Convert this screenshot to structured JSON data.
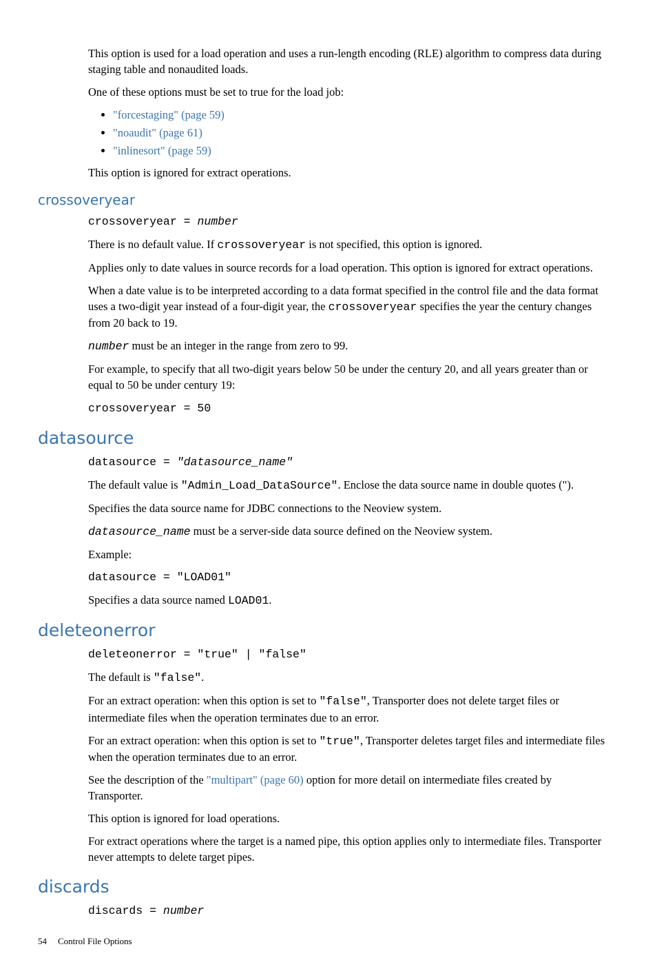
{
  "intro": {
    "p1": "This option is used for a load operation and uses a run-length encoding (RLE) algorithm to compress data during staging table and nonaudited loads.",
    "p2": "One of these options must be set to true for the load job:",
    "items": [
      "\"forcestaging\" (page 59)",
      "\"noaudit\" (page 61)",
      "\"inlinesort\" (page 59)"
    ],
    "p3": "This option is ignored for extract operations."
  },
  "crossoveryear": {
    "heading": "crossoveryear",
    "syntax_pre": "crossoveryear = ",
    "syntax_em": "number",
    "p1a": "There is no default value. If ",
    "p1b": "crossoveryear",
    "p1c": " is not specified, this option is ignored.",
    "p2": "Applies only to date values in source records for a load operation. This option is ignored for extract operations.",
    "p3a": "When a date value is to be interpreted according to a data format specified in the control file and the data format uses a two-digit year instead of a four-digit year, the ",
    "p3b": "crossoveryear",
    "p3c": " specifies the year the century changes from 20 back to 19.",
    "p4a": "number",
    "p4b": " must be an integer in the range from zero to 99.",
    "p5": "For example, to specify that all two-digit years below 50 be under the century 20, and all years greater than or equal to 50 be under century 19:",
    "example": "crossoveryear = 50"
  },
  "datasource": {
    "heading": "datasource",
    "syntax_pre": "datasource = ",
    "syntax_em": "\"datasource_name\"",
    "p1a": "The default value is ",
    "p1b": "\"Admin_Load_DataSource\"",
    "p1c": ". Enclose the data source name in double quotes (\").",
    "p2": "Specifies the data source name for JDBC connections to the Neoview system.",
    "p3a": "datasource_name",
    "p3b": " must be a server-side data source defined on the Neoview system.",
    "p4": "Example:",
    "example": "datasource = \"LOAD01\"",
    "p5a": "Specifies a data source named ",
    "p5b": "LOAD01",
    "p5c": "."
  },
  "deleteonerror": {
    "heading": "deleteonerror",
    "syntax": "deleteonerror = \"true\" | \"false\"",
    "p1a": "The default is ",
    "p1b": "\"false\"",
    "p1c": ".",
    "p2a": "For an extract operation: when this option is set to ",
    "p2b": "\"false\"",
    "p2c": ", Transporter does not delete target files or intermediate files when the operation terminates due to an error.",
    "p3a": "For an extract operation: when this option is set to ",
    "p3b": "\"true\"",
    "p3c": ", Transporter deletes target files and intermediate files when the operation terminates due to an error.",
    "p4a": "See the description of the ",
    "p4b": "\"multipart\" (page 60)",
    "p4c": " option for more detail on intermediate files created by Transporter.",
    "p5": "This option is ignored for load operations.",
    "p6": "For extract operations where the target is a named pipe, this option applies only to intermediate files. Transporter never attempts to delete target pipes."
  },
  "discards": {
    "heading": "discards",
    "syntax_pre": "discards = ",
    "syntax_em": "number"
  },
  "footer": {
    "page": "54",
    "title": "Control File Options"
  }
}
